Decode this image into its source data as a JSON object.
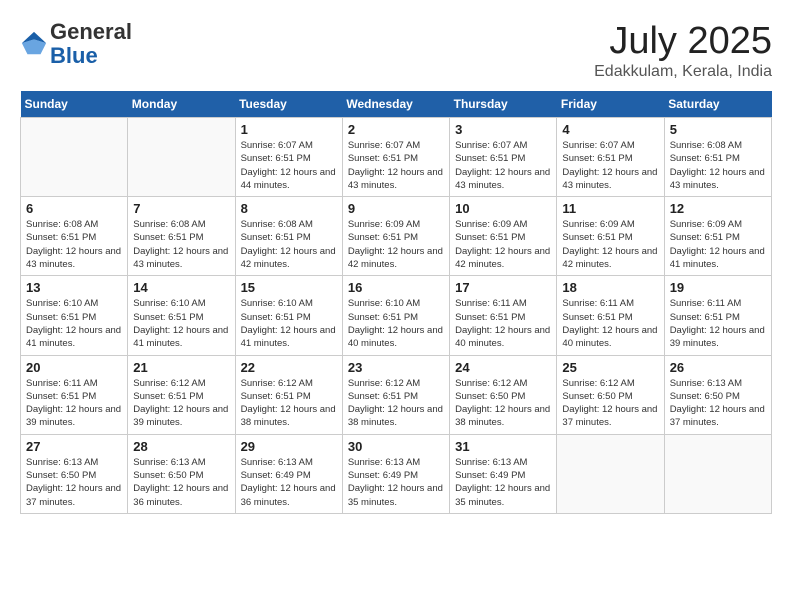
{
  "header": {
    "logo_general": "General",
    "logo_blue": "Blue",
    "month": "July 2025",
    "location": "Edakkulam, Kerala, India"
  },
  "calendar": {
    "days_of_week": [
      "Sunday",
      "Monday",
      "Tuesday",
      "Wednesday",
      "Thursday",
      "Friday",
      "Saturday"
    ],
    "weeks": [
      [
        {
          "day": "",
          "sunrise": "",
          "sunset": "",
          "daylight": ""
        },
        {
          "day": "",
          "sunrise": "",
          "sunset": "",
          "daylight": ""
        },
        {
          "day": "1",
          "sunrise": "Sunrise: 6:07 AM",
          "sunset": "Sunset: 6:51 PM",
          "daylight": "Daylight: 12 hours and 44 minutes."
        },
        {
          "day": "2",
          "sunrise": "Sunrise: 6:07 AM",
          "sunset": "Sunset: 6:51 PM",
          "daylight": "Daylight: 12 hours and 43 minutes."
        },
        {
          "day": "3",
          "sunrise": "Sunrise: 6:07 AM",
          "sunset": "Sunset: 6:51 PM",
          "daylight": "Daylight: 12 hours and 43 minutes."
        },
        {
          "day": "4",
          "sunrise": "Sunrise: 6:07 AM",
          "sunset": "Sunset: 6:51 PM",
          "daylight": "Daylight: 12 hours and 43 minutes."
        },
        {
          "day": "5",
          "sunrise": "Sunrise: 6:08 AM",
          "sunset": "Sunset: 6:51 PM",
          "daylight": "Daylight: 12 hours and 43 minutes."
        }
      ],
      [
        {
          "day": "6",
          "sunrise": "Sunrise: 6:08 AM",
          "sunset": "Sunset: 6:51 PM",
          "daylight": "Daylight: 12 hours and 43 minutes."
        },
        {
          "day": "7",
          "sunrise": "Sunrise: 6:08 AM",
          "sunset": "Sunset: 6:51 PM",
          "daylight": "Daylight: 12 hours and 43 minutes."
        },
        {
          "day": "8",
          "sunrise": "Sunrise: 6:08 AM",
          "sunset": "Sunset: 6:51 PM",
          "daylight": "Daylight: 12 hours and 42 minutes."
        },
        {
          "day": "9",
          "sunrise": "Sunrise: 6:09 AM",
          "sunset": "Sunset: 6:51 PM",
          "daylight": "Daylight: 12 hours and 42 minutes."
        },
        {
          "day": "10",
          "sunrise": "Sunrise: 6:09 AM",
          "sunset": "Sunset: 6:51 PM",
          "daylight": "Daylight: 12 hours and 42 minutes."
        },
        {
          "day": "11",
          "sunrise": "Sunrise: 6:09 AM",
          "sunset": "Sunset: 6:51 PM",
          "daylight": "Daylight: 12 hours and 42 minutes."
        },
        {
          "day": "12",
          "sunrise": "Sunrise: 6:09 AM",
          "sunset": "Sunset: 6:51 PM",
          "daylight": "Daylight: 12 hours and 41 minutes."
        }
      ],
      [
        {
          "day": "13",
          "sunrise": "Sunrise: 6:10 AM",
          "sunset": "Sunset: 6:51 PM",
          "daylight": "Daylight: 12 hours and 41 minutes."
        },
        {
          "day": "14",
          "sunrise": "Sunrise: 6:10 AM",
          "sunset": "Sunset: 6:51 PM",
          "daylight": "Daylight: 12 hours and 41 minutes."
        },
        {
          "day": "15",
          "sunrise": "Sunrise: 6:10 AM",
          "sunset": "Sunset: 6:51 PM",
          "daylight": "Daylight: 12 hours and 41 minutes."
        },
        {
          "day": "16",
          "sunrise": "Sunrise: 6:10 AM",
          "sunset": "Sunset: 6:51 PM",
          "daylight": "Daylight: 12 hours and 40 minutes."
        },
        {
          "day": "17",
          "sunrise": "Sunrise: 6:11 AM",
          "sunset": "Sunset: 6:51 PM",
          "daylight": "Daylight: 12 hours and 40 minutes."
        },
        {
          "day": "18",
          "sunrise": "Sunrise: 6:11 AM",
          "sunset": "Sunset: 6:51 PM",
          "daylight": "Daylight: 12 hours and 40 minutes."
        },
        {
          "day": "19",
          "sunrise": "Sunrise: 6:11 AM",
          "sunset": "Sunset: 6:51 PM",
          "daylight": "Daylight: 12 hours and 39 minutes."
        }
      ],
      [
        {
          "day": "20",
          "sunrise": "Sunrise: 6:11 AM",
          "sunset": "Sunset: 6:51 PM",
          "daylight": "Daylight: 12 hours and 39 minutes."
        },
        {
          "day": "21",
          "sunrise": "Sunrise: 6:12 AM",
          "sunset": "Sunset: 6:51 PM",
          "daylight": "Daylight: 12 hours and 39 minutes."
        },
        {
          "day": "22",
          "sunrise": "Sunrise: 6:12 AM",
          "sunset": "Sunset: 6:51 PM",
          "daylight": "Daylight: 12 hours and 38 minutes."
        },
        {
          "day": "23",
          "sunrise": "Sunrise: 6:12 AM",
          "sunset": "Sunset: 6:51 PM",
          "daylight": "Daylight: 12 hours and 38 minutes."
        },
        {
          "day": "24",
          "sunrise": "Sunrise: 6:12 AM",
          "sunset": "Sunset: 6:50 PM",
          "daylight": "Daylight: 12 hours and 38 minutes."
        },
        {
          "day": "25",
          "sunrise": "Sunrise: 6:12 AM",
          "sunset": "Sunset: 6:50 PM",
          "daylight": "Daylight: 12 hours and 37 minutes."
        },
        {
          "day": "26",
          "sunrise": "Sunrise: 6:13 AM",
          "sunset": "Sunset: 6:50 PM",
          "daylight": "Daylight: 12 hours and 37 minutes."
        }
      ],
      [
        {
          "day": "27",
          "sunrise": "Sunrise: 6:13 AM",
          "sunset": "Sunset: 6:50 PM",
          "daylight": "Daylight: 12 hours and 37 minutes."
        },
        {
          "day": "28",
          "sunrise": "Sunrise: 6:13 AM",
          "sunset": "Sunset: 6:50 PM",
          "daylight": "Daylight: 12 hours and 36 minutes."
        },
        {
          "day": "29",
          "sunrise": "Sunrise: 6:13 AM",
          "sunset": "Sunset: 6:49 PM",
          "daylight": "Daylight: 12 hours and 36 minutes."
        },
        {
          "day": "30",
          "sunrise": "Sunrise: 6:13 AM",
          "sunset": "Sunset: 6:49 PM",
          "daylight": "Daylight: 12 hours and 35 minutes."
        },
        {
          "day": "31",
          "sunrise": "Sunrise: 6:13 AM",
          "sunset": "Sunset: 6:49 PM",
          "daylight": "Daylight: 12 hours and 35 minutes."
        },
        {
          "day": "",
          "sunrise": "",
          "sunset": "",
          "daylight": ""
        },
        {
          "day": "",
          "sunrise": "",
          "sunset": "",
          "daylight": ""
        }
      ]
    ]
  }
}
